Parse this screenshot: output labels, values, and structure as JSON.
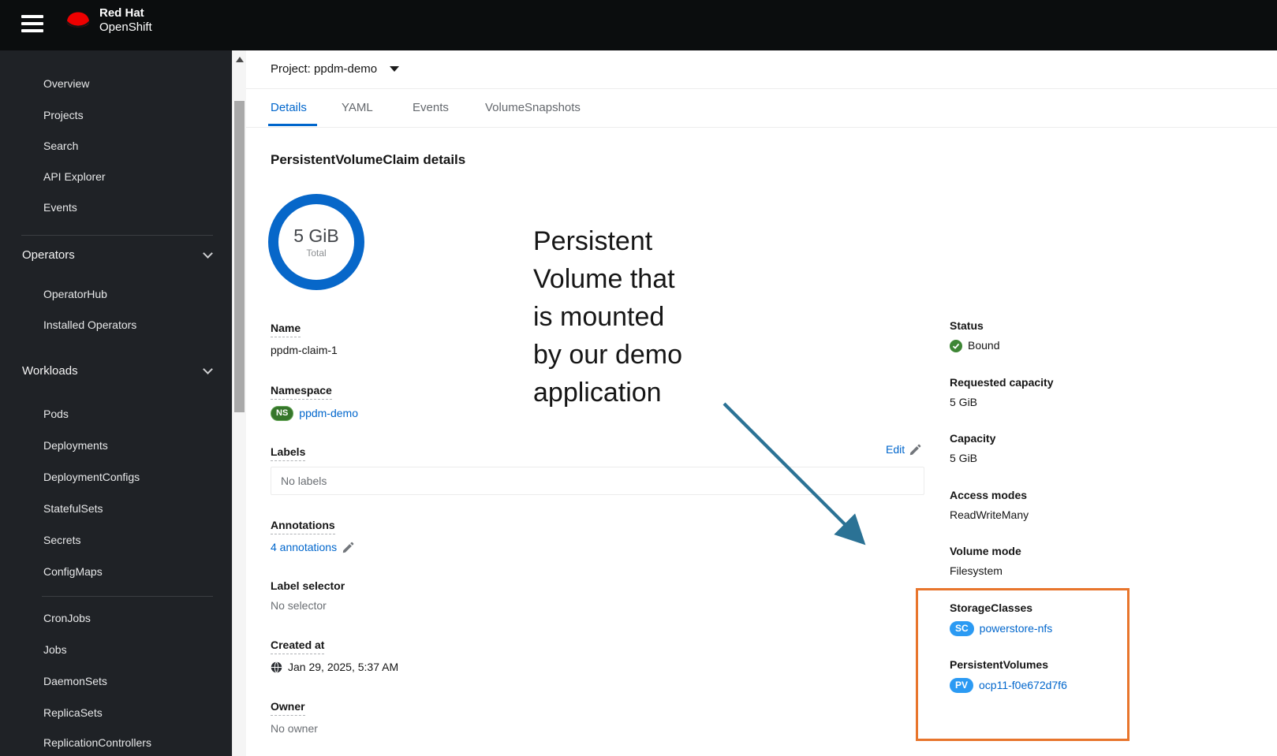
{
  "masthead": {
    "brand_top": "Red Hat",
    "brand_bottom": "OpenShift"
  },
  "project_bar": {
    "label": "Project: ppdm-demo"
  },
  "tabs": {
    "active": "Details",
    "items": [
      {
        "label": "Details"
      },
      {
        "label": "YAML"
      },
      {
        "label": "Events"
      },
      {
        "label": "VolumeSnapshots"
      }
    ]
  },
  "sidebar": {
    "items": [
      {
        "label": "Overview"
      },
      {
        "label": "Projects"
      },
      {
        "label": "Search"
      },
      {
        "label": "API Explorer"
      },
      {
        "label": "Events"
      },
      {
        "label": "Operators"
      },
      {
        "label": "OperatorHub"
      },
      {
        "label": "Installed Operators"
      },
      {
        "label": "Workloads"
      },
      {
        "label": "Pods"
      },
      {
        "label": "Deployments"
      },
      {
        "label": "DeploymentConfigs"
      },
      {
        "label": "StatefulSets"
      },
      {
        "label": "Secrets"
      },
      {
        "label": "ConfigMaps"
      },
      {
        "label": "CronJobs"
      },
      {
        "label": "Jobs"
      },
      {
        "label": "DaemonSets"
      },
      {
        "label": "ReplicaSets"
      },
      {
        "label": "ReplicationControllers"
      }
    ]
  },
  "page": {
    "title": "PersistentVolumeClaim details"
  },
  "donut": {
    "value": "5 GiB",
    "caption": "Total"
  },
  "details": {
    "name": {
      "label": "Name",
      "value": "ppdm-claim-1"
    },
    "namespace": {
      "label": "Namespace",
      "badge": "NS",
      "value": "ppdm-demo"
    },
    "labels": {
      "label": "Labels",
      "edit_label": "Edit",
      "empty": "No labels"
    },
    "annotations": {
      "label": "Annotations",
      "link": "4 annotations"
    },
    "label_selector": {
      "label": "Label selector",
      "value": "No selector"
    },
    "created_at": {
      "label": "Created at",
      "value": "Jan 29, 2025, 5:37 AM"
    },
    "owner": {
      "label": "Owner",
      "value": "No owner"
    }
  },
  "status_column": {
    "status": {
      "label": "Status",
      "value": "Bound"
    },
    "requested_capacity": {
      "label": "Requested capacity",
      "value": "5 GiB"
    },
    "capacity": {
      "label": "Capacity",
      "value": "5 GiB"
    },
    "access_modes": {
      "label": "Access modes",
      "value": "ReadWriteMany"
    },
    "volume_mode": {
      "label": "Volume mode",
      "value": "Filesystem"
    },
    "storage_classes": {
      "label": "StorageClasses",
      "badge": "SC",
      "value": "powerstore-nfs"
    },
    "persistent_volumes": {
      "label": "PersistentVolumes",
      "badge": "PV",
      "value": "ocp11-f0e672d7f6"
    }
  },
  "callout": {
    "lines": [
      "Persistent",
      "Volume that",
      "is mounted",
      "by our demo",
      "application"
    ]
  },
  "colors": {
    "accent_blue": "#0066cc",
    "donut_blue": "#0767c9",
    "badge_blue": "#2b9af3",
    "namespace_green": "#36762b",
    "status_green": "#3e8635",
    "highlight_orange": "#e8752c",
    "arrow_teal": "#2b7295",
    "masthead_black": "#0b0d0e",
    "sidebar_dark": "#1f2226"
  }
}
